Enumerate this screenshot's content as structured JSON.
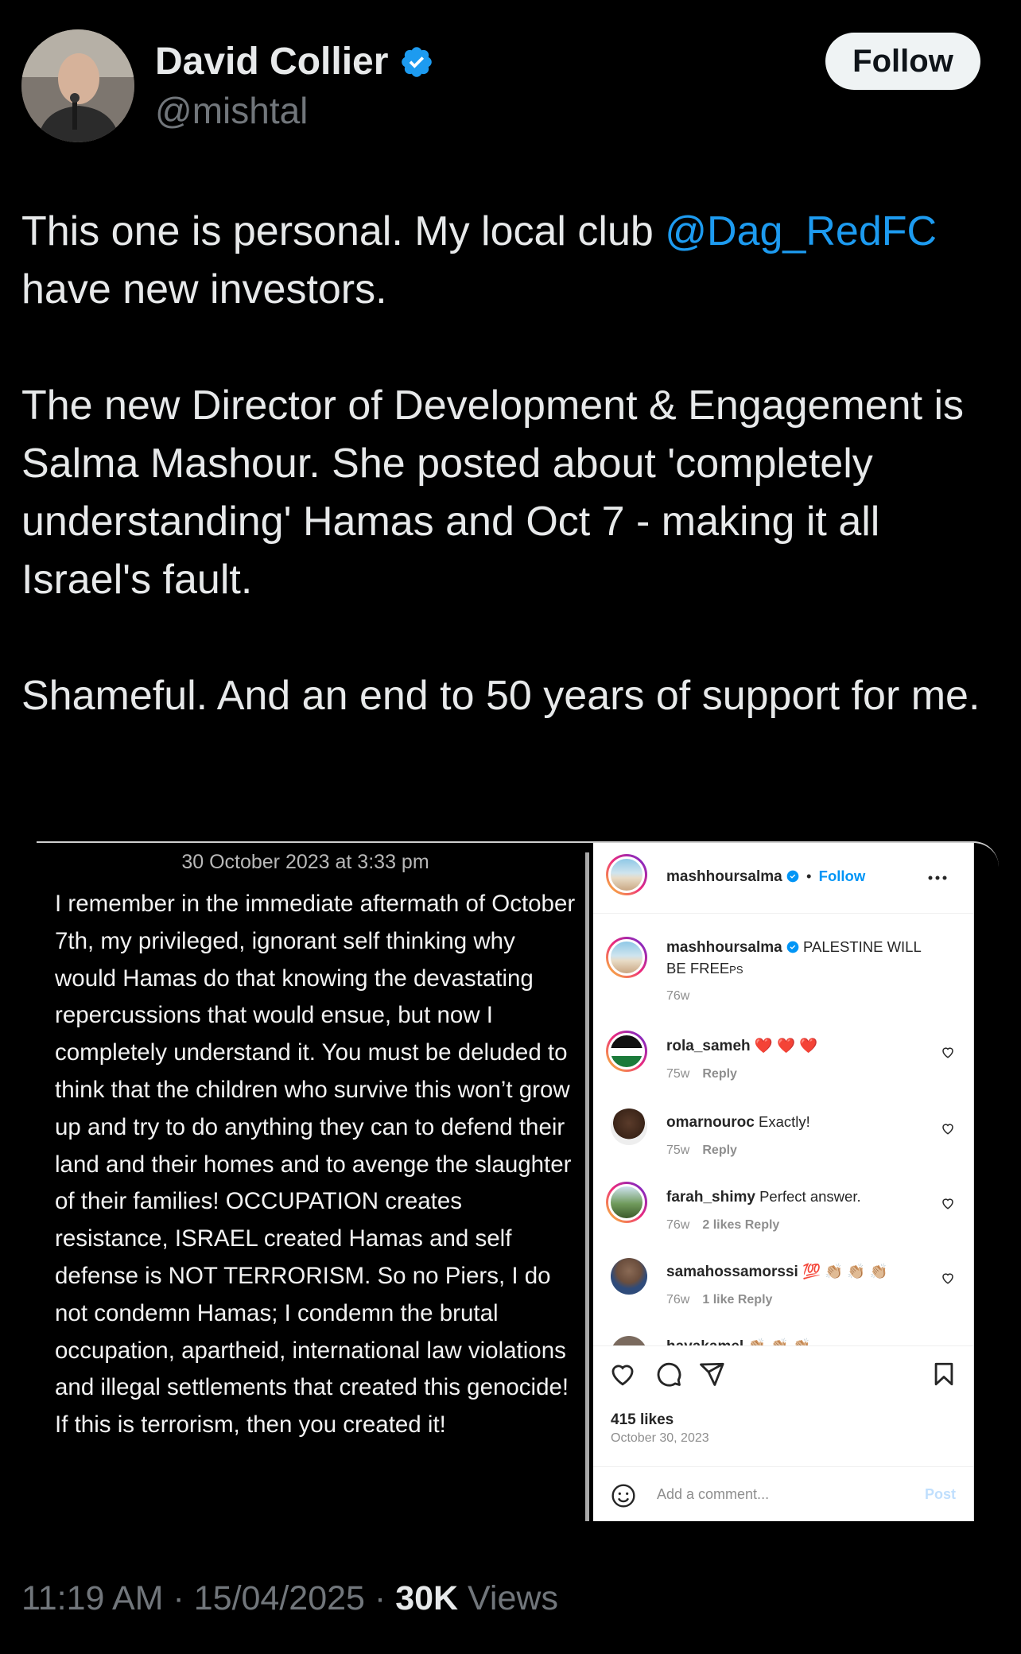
{
  "author": {
    "name": "David Collier",
    "handle": "@mishtal",
    "verified": true
  },
  "follow_label": "Follow",
  "tweet": {
    "line1_prefix": "This one is personal. My local club ",
    "mention": "@Dag_RedFC",
    "line2": "have new investors.",
    "para2": "The new Director of Development & Engagement is Salma Mashour. She posted about  'completely understanding' Hamas and Oct 7 - making it all Israel's fault.",
    "para3": "Shameful. And an end to 50 years of support for me."
  },
  "media": {
    "timestamp": "30 October 2023 at 3:33 pm",
    "note": "I remember in the immediate aftermath of October 7th, my privileged, ignorant self thinking why would Hamas do that knowing the devastating repercussions that would ensue, but now I completely understand it. You must be deluded to think that the children who survive this won’t grow up and try to do anything they can to defend their land and their homes and to avenge the slaughter of their families! OCCUPATION creates resistance, ISRAEL created Hamas and self defense is NOT TERRORISM.  So no Piers, I do not condemn Hamas; I condemn the brutal occupation, apartheid, international law violations and illegal settlements that created this genocide! If this is terrorism, then you created it!",
    "instagram": {
      "header_user": "mashhoursalma",
      "header_dot": "•",
      "header_follow": "Follow",
      "caption_user": "mashhoursalma",
      "caption_text": "PALESTINE WILL BE FREE",
      "caption_tail": "PS",
      "caption_age": "76w",
      "comments": [
        {
          "user": "rola_sameh",
          "text": "❤️ ❤️ ❤️",
          "age": "75w",
          "likes": "",
          "reply": "Reply"
        },
        {
          "user": "omarnouroc",
          "text": "Exactly!",
          "age": "75w",
          "likes": "",
          "reply": "Reply"
        },
        {
          "user": "farah_shimy",
          "text": "Perfect answer.",
          "age": "76w",
          "likes": "2 likes",
          "reply": "Reply"
        },
        {
          "user": "samahossamorssi",
          "text": "💯 👏🏼 👏🏼 👏🏼",
          "age": "76w",
          "likes": "1 like",
          "reply": "Reply"
        },
        {
          "user": "hayakamel",
          "text": "👏🏼 👏🏼 👏🏼",
          "age": "",
          "likes": "",
          "reply": ""
        }
      ],
      "likes": "415 likes",
      "date": "October 30, 2023",
      "add_comment_placeholder": "Add a comment...",
      "post_label": "Post"
    }
  },
  "footer": {
    "time": "11:19 AM",
    "sep1": "·",
    "date": "15/04/2025",
    "sep2": "·",
    "views_count": "30K",
    "views_label": "Views"
  },
  "colors": {
    "background": "#000000",
    "text": "#e7e9ea",
    "secondary": "#71767b",
    "link": "#1d9bf0",
    "ig_blue": "#0095f6"
  }
}
